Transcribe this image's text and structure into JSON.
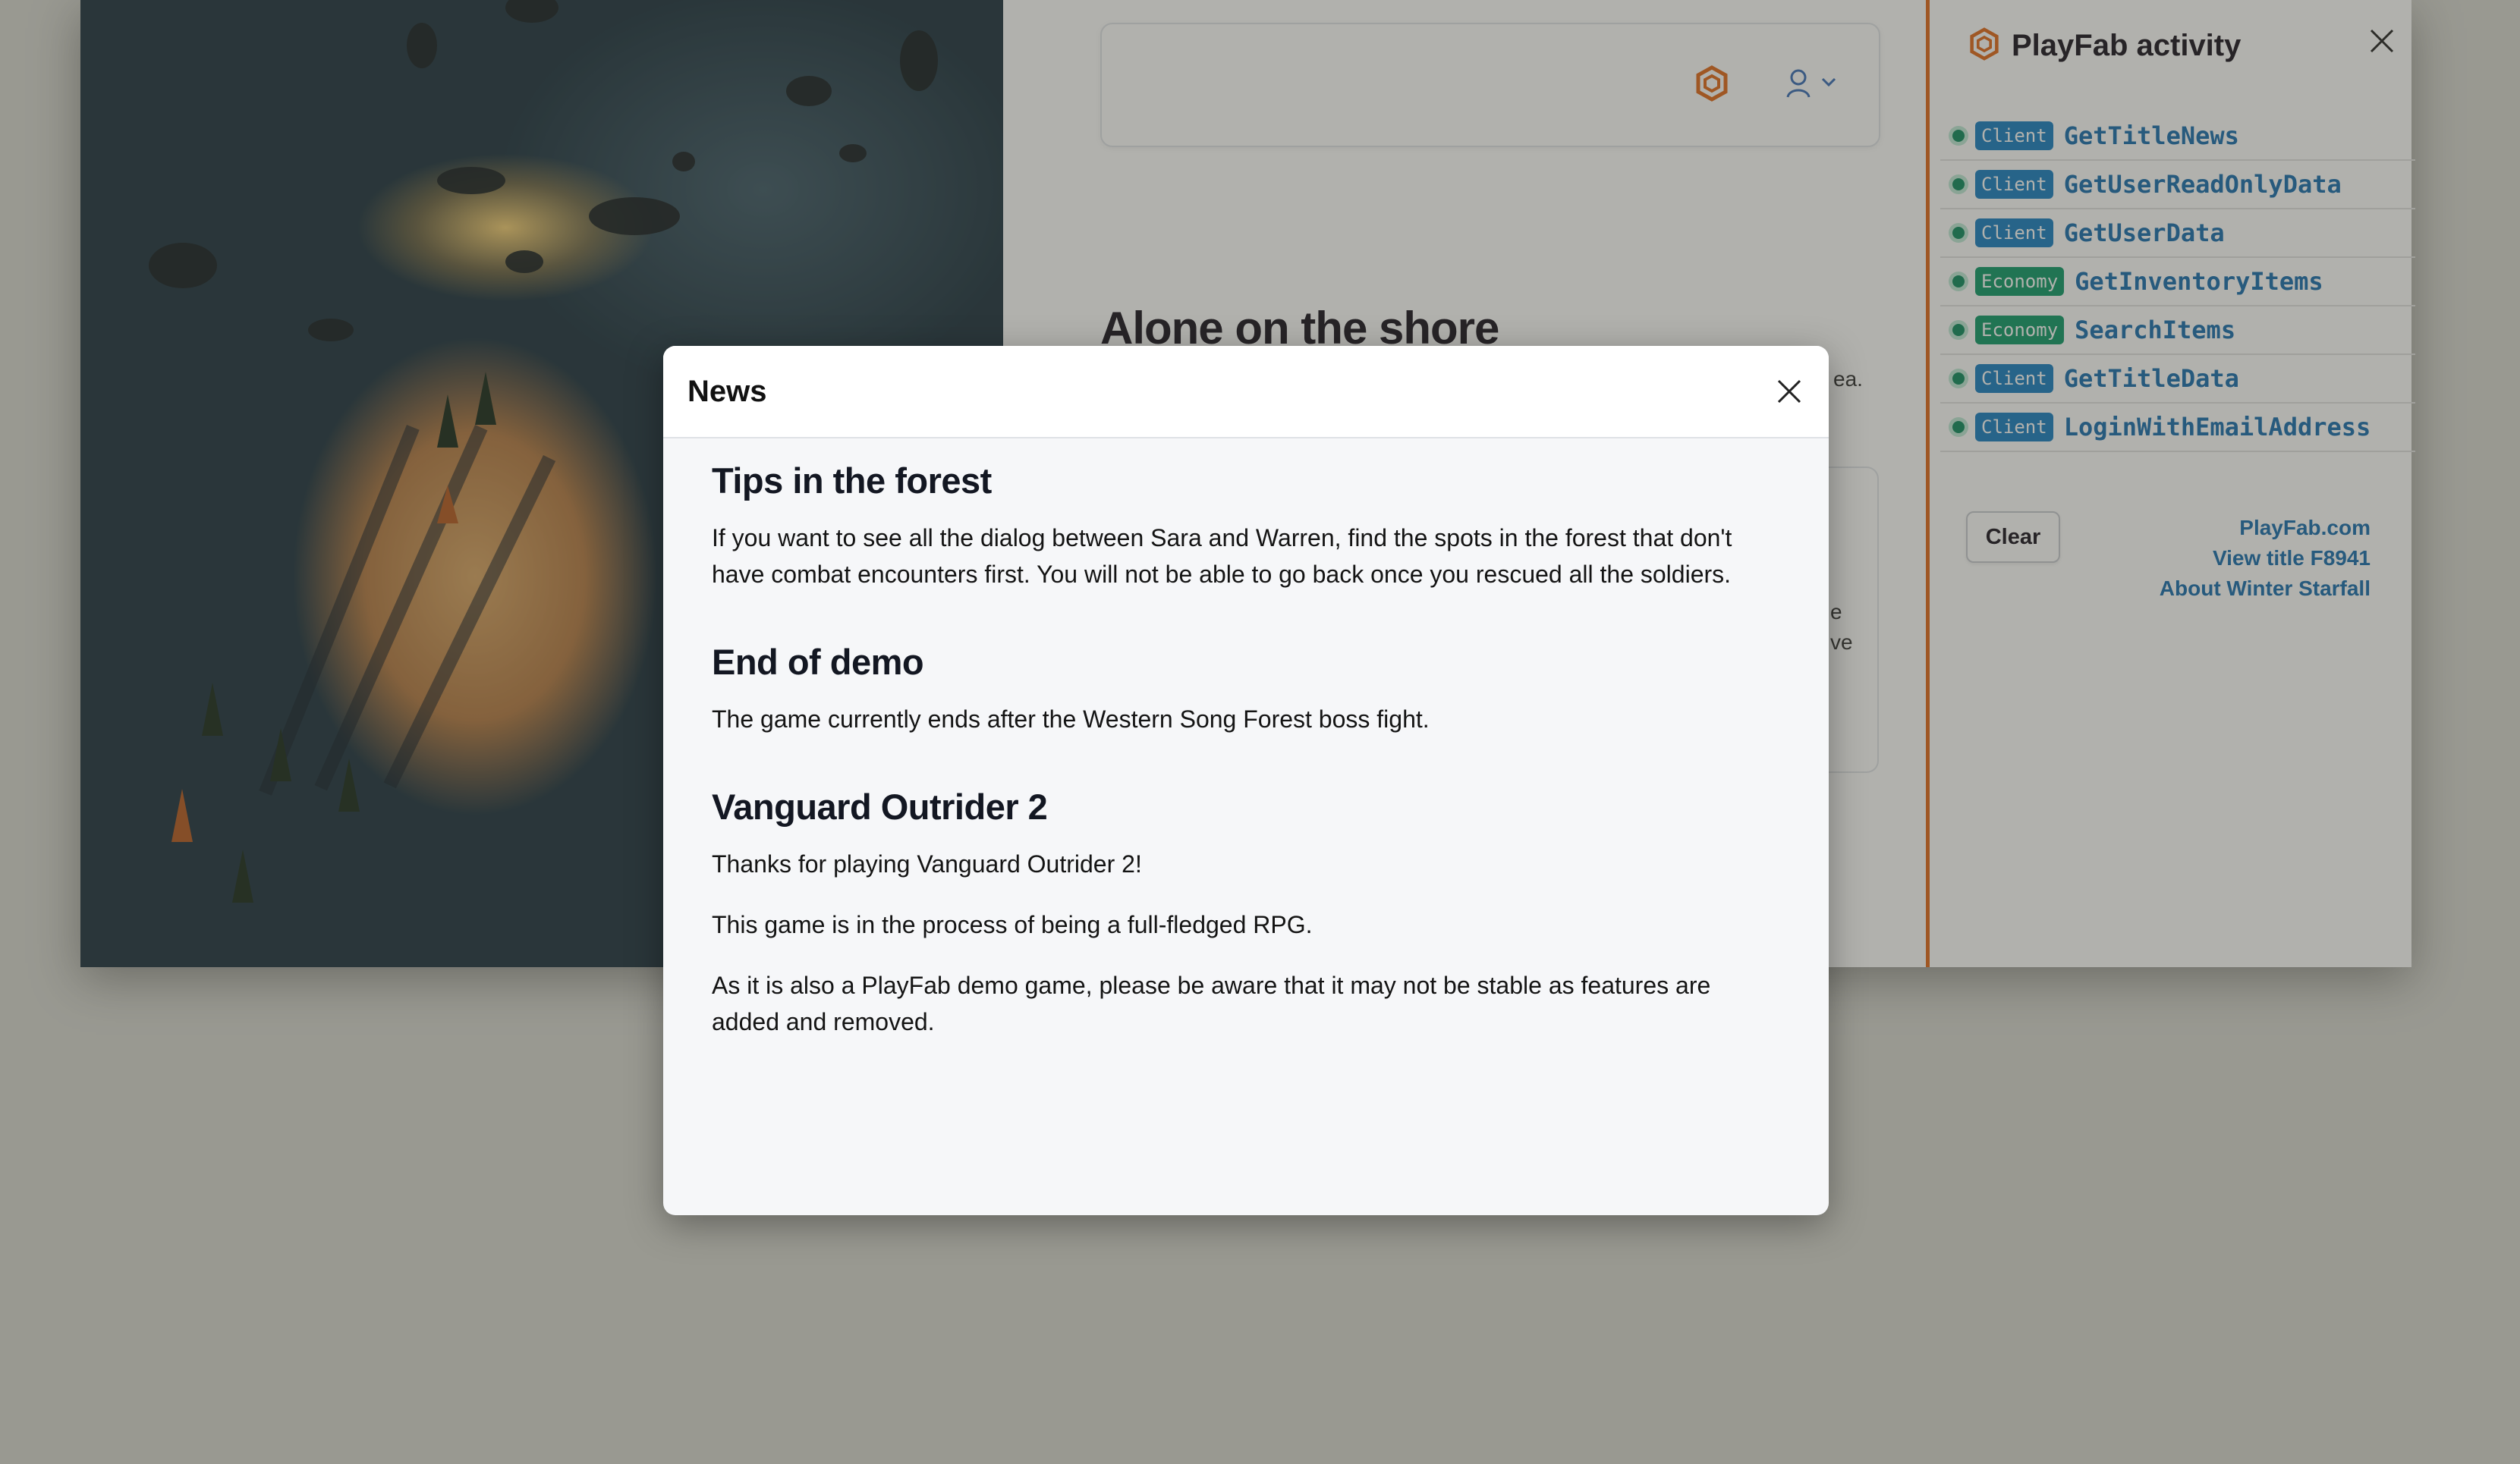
{
  "page": {
    "title": "Alone on the shore",
    "subtitle_trailing_fragment": "ea.",
    "card_text_fragments": [
      "e",
      "ve"
    ]
  },
  "header": {
    "playfab_icon": "playfab-hexagon-icon",
    "user_icon": "user-icon",
    "menu_icon": "chevron-down-icon"
  },
  "activity": {
    "title": "PlayFab activity",
    "items": [
      {
        "badge": "Client",
        "api": "GetTitleNews"
      },
      {
        "badge": "Client",
        "api": "GetUserReadOnlyData"
      },
      {
        "badge": "Client",
        "api": "GetUserData"
      },
      {
        "badge": "Economy",
        "api": "GetInventoryItems"
      },
      {
        "badge": "Economy",
        "api": "SearchItems"
      },
      {
        "badge": "Client",
        "api": "GetTitleData"
      },
      {
        "badge": "Client",
        "api": "LoginWithEmailAddress"
      }
    ],
    "clear_label": "Clear",
    "links": [
      "PlayFab.com",
      "View title F8941",
      "About Winter Starfall"
    ]
  },
  "modal": {
    "title": "News",
    "items": [
      {
        "heading": "Tips in the forest",
        "paragraphs": [
          "If you want to see all the dialog between Sara and Warren, find the spots in the forest that don't have combat encounters first. You will not be able to go back once you rescued all the soldiers."
        ]
      },
      {
        "heading": "End of demo",
        "paragraphs": [
          "The game currently ends after the Western Song Forest boss fight."
        ]
      },
      {
        "heading": "Vanguard Outrider 2",
        "paragraphs": [
          "Thanks for playing Vanguard Outrider 2!",
          "This game is in the process of being a full-fledged RPG.",
          "As it is also a PlayFab demo game, please be aware that it may not be stable as features are added and removed."
        ]
      }
    ]
  },
  "colors": {
    "accent_orange": "#e26a1c",
    "client_badge": "#1a7fc4",
    "economy_badge": "#0f9a6a",
    "link_blue": "#1a6fb0"
  }
}
